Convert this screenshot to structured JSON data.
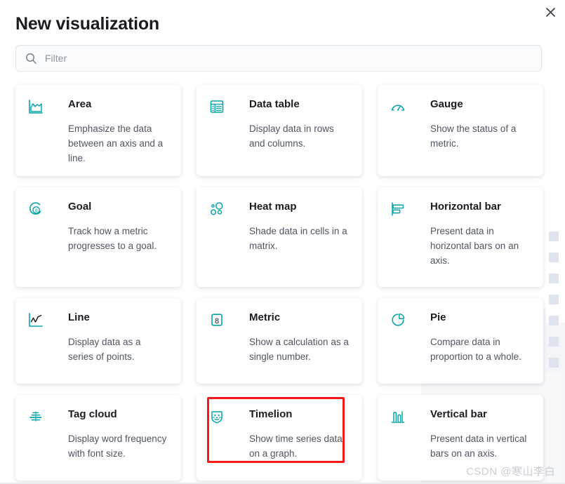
{
  "modal": {
    "title": "New visualization",
    "close_label": "×",
    "close_icon": "close-icon"
  },
  "search": {
    "placeholder": "Filter",
    "value": "",
    "icon": "search-icon"
  },
  "colors": {
    "icon_teal": "#07a5ab",
    "highlight_red": "#f51818",
    "title_text": "#1a1c21",
    "body_text": "#4f5561",
    "placeholder_text": "#8e95a3",
    "card_background": "#ffffff",
    "page_background": "#ffffff",
    "decor_square": "#dfe5ef",
    "watermark_text": "#c9ccd3"
  },
  "visualizations": [
    {
      "title": "Area",
      "description": "Emphasize the data between an axis and a line.",
      "icon": "area-chart-icon",
      "highlighted": false
    },
    {
      "title": "Data table",
      "description": "Display data in rows and columns.",
      "icon": "data-table-icon",
      "highlighted": false
    },
    {
      "title": "Gauge",
      "description": "Show the status of a metric.",
      "icon": "gauge-icon",
      "highlighted": false
    },
    {
      "title": "Goal",
      "description": "Track how a metric progresses to a goal.",
      "icon": "goal-icon",
      "highlighted": false
    },
    {
      "title": "Heat map",
      "description": "Shade data in cells in a matrix.",
      "icon": "heat-map-icon",
      "highlighted": false
    },
    {
      "title": "Horizontal bar",
      "description": "Present data in horizontal bars on an axis.",
      "icon": "horizontal-bar-icon",
      "highlighted": false
    },
    {
      "title": "Line",
      "description": "Display data as a series of points.",
      "icon": "line-chart-icon",
      "highlighted": false
    },
    {
      "title": "Metric",
      "description": "Show a calculation as a single number.",
      "icon": "metric-icon",
      "highlighted": false
    },
    {
      "title": "Pie",
      "description": "Compare data in proportion to a whole.",
      "icon": "pie-chart-icon",
      "highlighted": false
    },
    {
      "title": "Tag cloud",
      "description": "Display word frequency with font size.",
      "icon": "tag-cloud-icon",
      "highlighted": false
    },
    {
      "title": "Timelion",
      "description": "Show time series data on a graph.",
      "icon": "timelion-lion-icon",
      "highlighted": true
    },
    {
      "title": "Vertical bar",
      "description": "Present data in vertical bars on an axis.",
      "icon": "vertical-bar-icon",
      "highlighted": false
    }
  ],
  "watermark": {
    "text": "CSDN @寒山李白"
  }
}
